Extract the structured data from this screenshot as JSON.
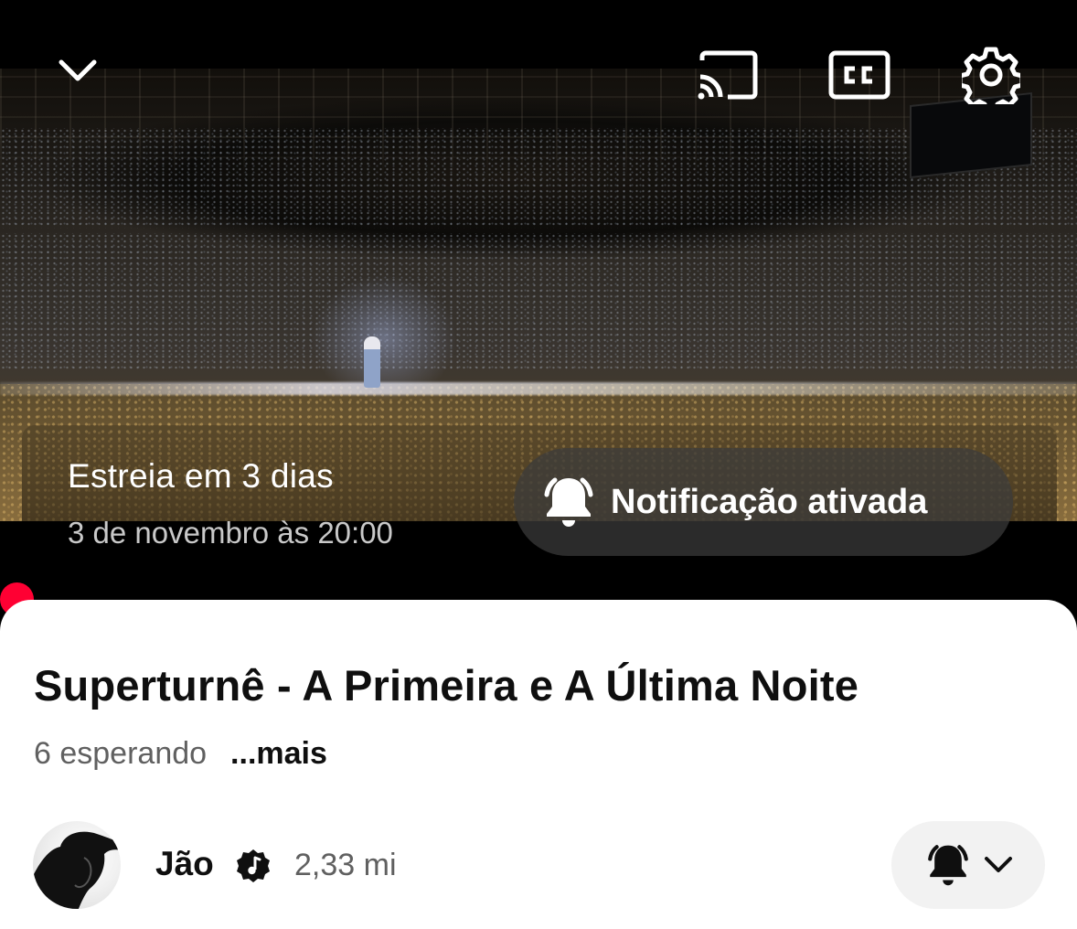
{
  "player": {
    "controls": {
      "minimize_icon": "chevron-down-icon",
      "cast_icon": "cast-icon",
      "captions_icon": "closed-captions-icon",
      "settings_icon": "gear-icon"
    },
    "premiere": {
      "title": "Estreia em 3 dias",
      "date": "3 de novembro às 20:00",
      "notify_label": "Notificação ativada",
      "notify_icon": "bell-ringing-icon"
    },
    "accent_color": "#ff0033"
  },
  "video": {
    "title": "Superturnê - A Primeira e A Última Noite",
    "waiting": "6 esperando",
    "more_label": "...mais"
  },
  "channel": {
    "name": "Jão",
    "badge_icon": "verified-music-icon",
    "subscribers": "2,33 mi",
    "subscribe_icon": "bell-ringing-icon",
    "dropdown_icon": "chevron-down-icon"
  }
}
